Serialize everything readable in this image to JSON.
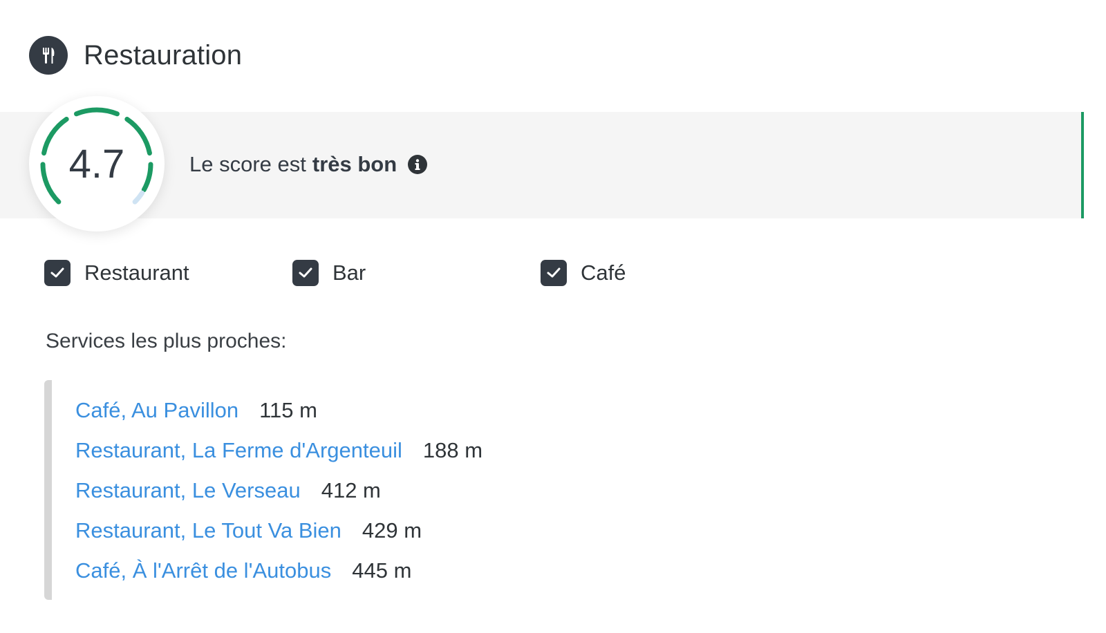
{
  "section": {
    "title": "Restauration",
    "icon": "fork-knife-icon"
  },
  "score": {
    "value": "4.7",
    "max": 5,
    "text_prefix": "Le score est",
    "text_rating": "très bon",
    "info_icon": "info-icon",
    "gauge_color": "#1c9a63",
    "gauge_track_color": "#cfe3f3"
  },
  "filters": [
    {
      "label": "Restaurant",
      "checked": true
    },
    {
      "label": "Bar",
      "checked": true
    },
    {
      "label": "Café",
      "checked": true
    }
  ],
  "services": {
    "heading": "Services les plus proches:",
    "items": [
      {
        "name": "Café, Au Pavillon",
        "distance": "115 m"
      },
      {
        "name": "Restaurant, La Ferme d'Argenteuil",
        "distance": "188 m"
      },
      {
        "name": "Restaurant, Le Verseau",
        "distance": "412 m"
      },
      {
        "name": "Restaurant, Le Tout Va Bien",
        "distance": "429 m"
      },
      {
        "name": "Café, À l'Arrêt de l'Autobus",
        "distance": "445 m"
      }
    ]
  },
  "colors": {
    "accent": "#1c9a63",
    "link": "#3a8fdf",
    "dark": "#343b44"
  }
}
